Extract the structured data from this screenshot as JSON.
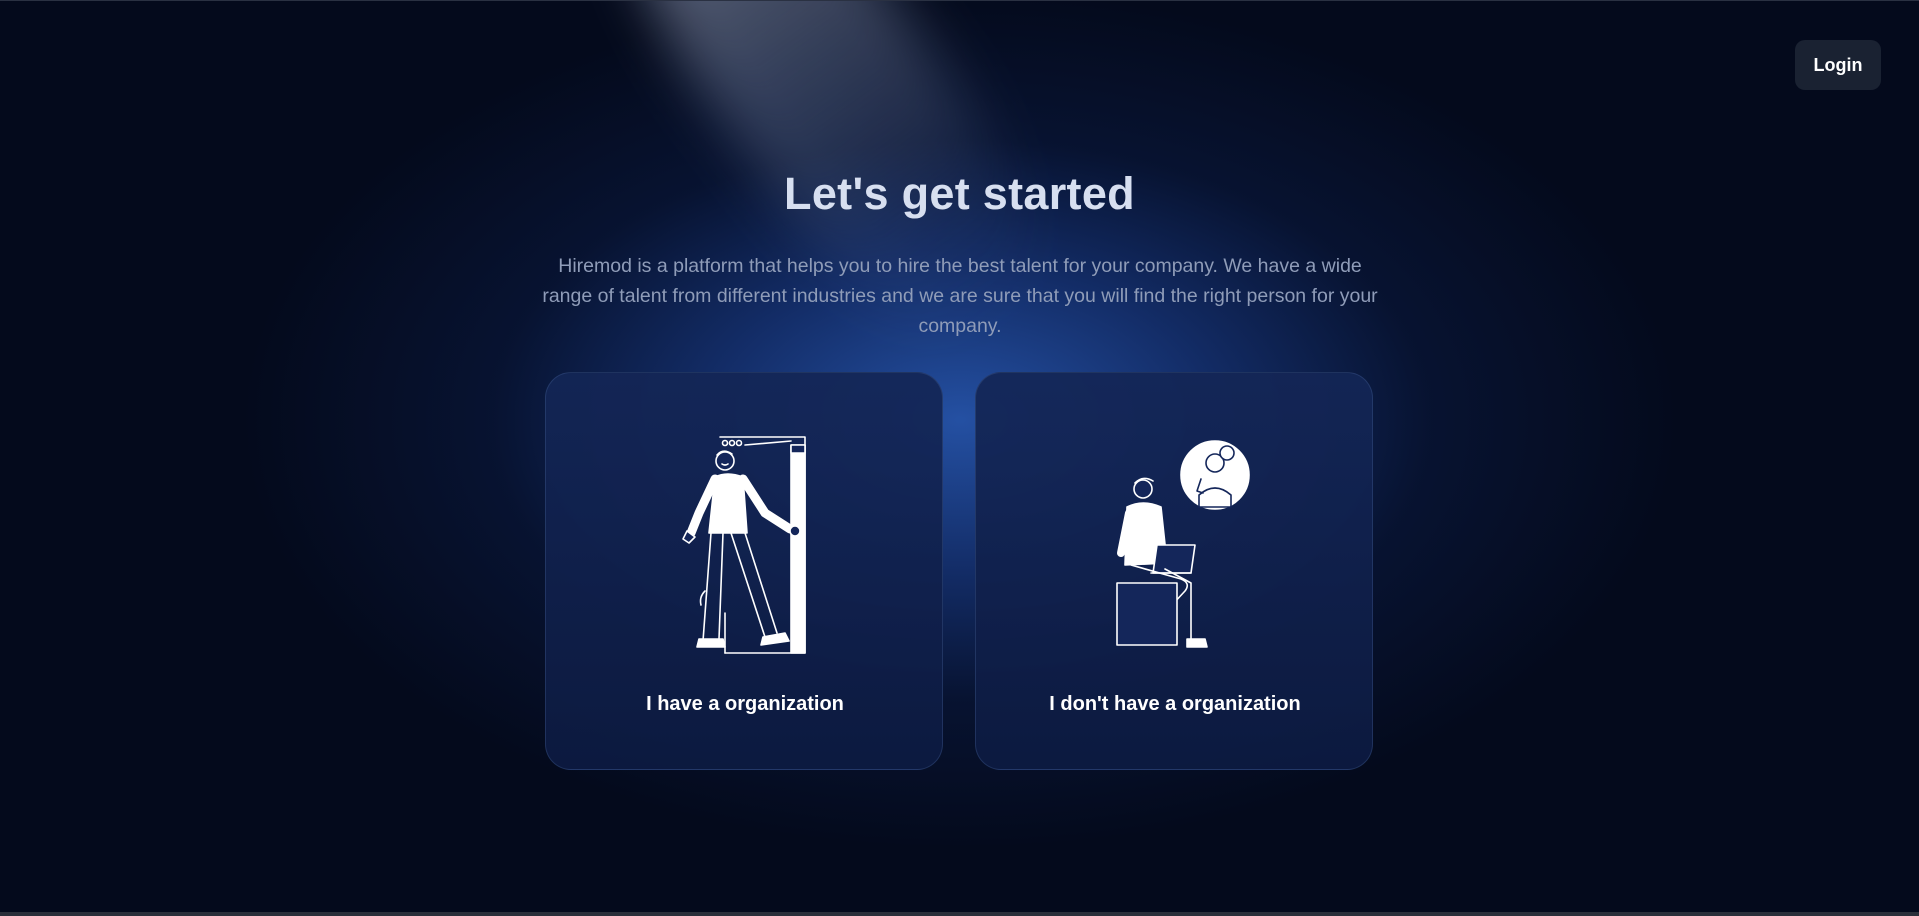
{
  "header": {
    "login_label": "Login"
  },
  "hero": {
    "title": "Let's get started",
    "description": "Hiremod is a platform that helps you to hire the best talent for your company. We have a wide range of talent from different industries and we are sure that you will find the right person for your company."
  },
  "options": [
    {
      "label": "I have a organization",
      "icon": "person-opening-door-icon"
    },
    {
      "label": "I don't have a organization",
      "icon": "person-with-laptop-icon"
    }
  ],
  "colors": {
    "background": "#040a1c",
    "glow": "#2654aa",
    "card": "#14265a",
    "button": "#1a2232",
    "title": "#d7dff0",
    "description": "#8f9cb8"
  }
}
